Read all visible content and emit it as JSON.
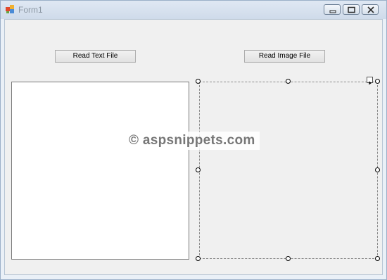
{
  "window": {
    "title": "Form1"
  },
  "buttons": {
    "read_text_label": "Read Text File",
    "read_image_label": "Read Image File"
  },
  "watermark": {
    "text": "© aspsnippets.com"
  },
  "icons": {
    "app": "windows-form-icon",
    "minimize": "minimize-icon",
    "maximize": "maximize-icon",
    "close": "close-icon",
    "smart_tag": "smart-tag-arrow-icon"
  },
  "colors": {
    "titlebar": "#d6e1ee",
    "form_background": "#f0f0f0",
    "watermark_text": "#777777"
  }
}
